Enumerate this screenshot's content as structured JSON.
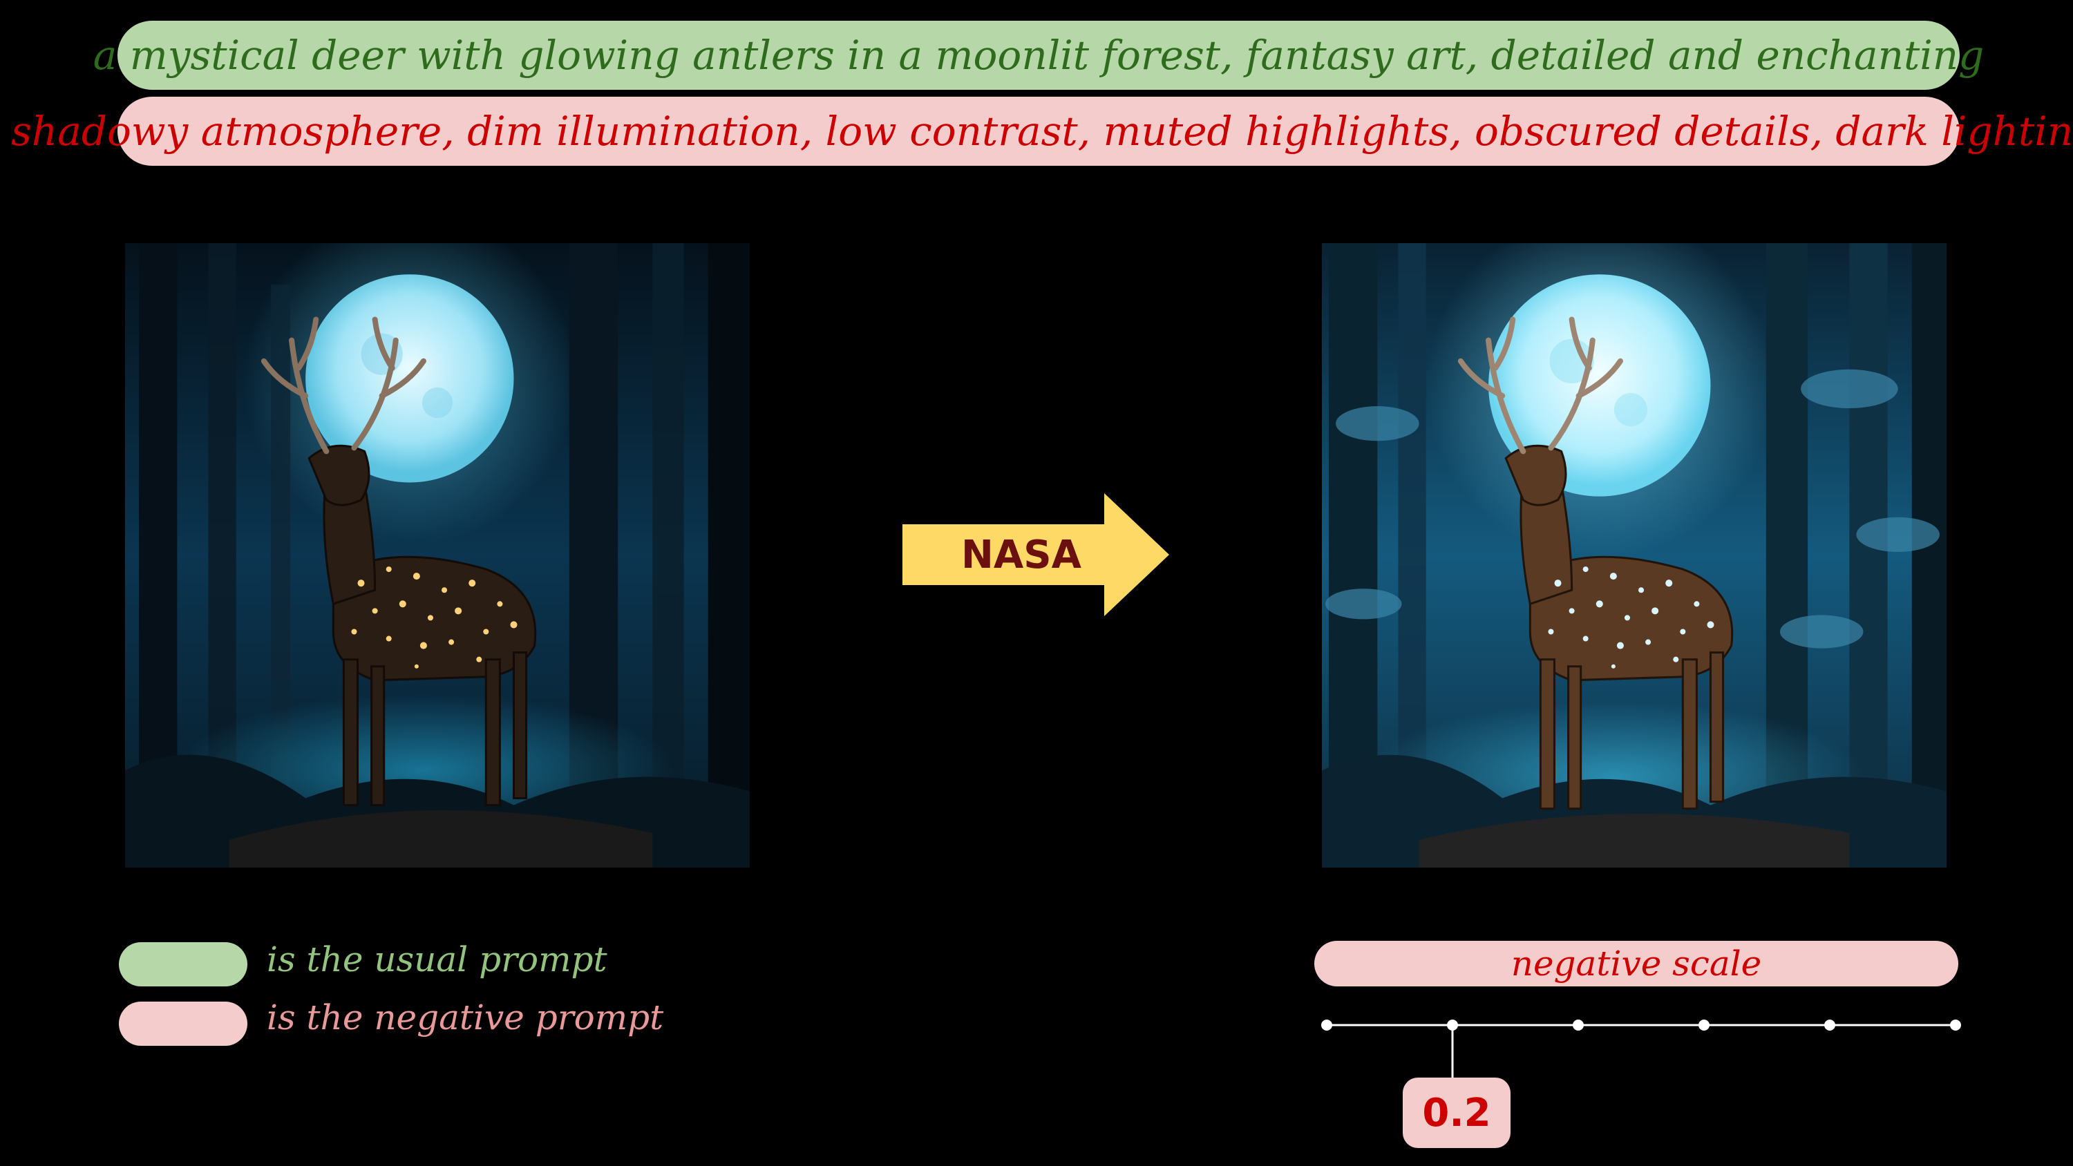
{
  "prompts": {
    "positive": "a mystical deer with glowing antlers in a moonlit forest, fantasy art, detailed and enchanting",
    "negative": "– shadowy atmosphere, dim illumination, low contrast, muted highlights, obscured details, dark lighting"
  },
  "arrow": {
    "label": "NASA"
  },
  "legend": {
    "positive_text": "is the usual prompt",
    "negative_text": "is the negative prompt"
  },
  "scale": {
    "label": "negative scale",
    "value": "0.2",
    "tick_count": 6,
    "selected_index": 1
  },
  "colors": {
    "background": "#000000",
    "positive_fill": "#b6d7a8",
    "positive_text": "#2e6b1c",
    "negative_fill": "#f4cccc",
    "negative_text": "#cc0000",
    "arrow_fill": "#ffd966",
    "arrow_text": "#6b0f0f"
  },
  "images": {
    "left": "deer-image-original",
    "right": "deer-image-nasa"
  }
}
